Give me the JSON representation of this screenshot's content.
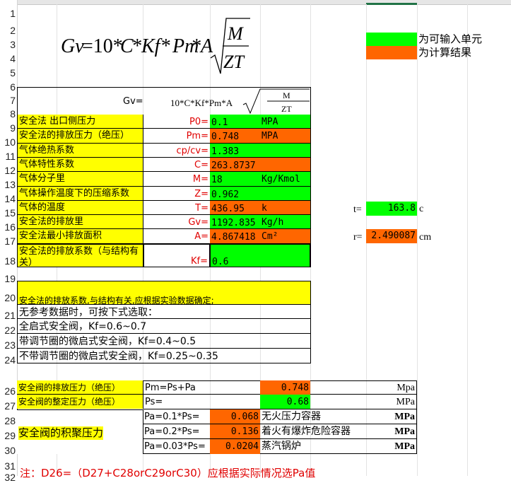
{
  "formula": {
    "lhs": "Gv",
    "eq": "=10*",
    "c": "C",
    "kf": "*Kf*",
    "pm": "Pm",
    "a": "*A",
    "num": "M",
    "den": "ZT"
  },
  "legend": {
    "input_label": "为可输入单元",
    "calc_label": "为计算结果"
  },
  "header_row": {
    "gv_label": "Gv=",
    "expr": "10*C*Kf*Pm*A",
    "num": "M",
    "den": "ZT"
  },
  "rows": [
    {
      "n": "9",
      "label": "安全法 出口侧压力",
      "sym": "P0=",
      "val": "0.1",
      "unit": "MPA",
      "color": "grn"
    },
    {
      "n": "10",
      "label": "安全法的排放压力（绝压）",
      "sym": "Pm=",
      "val": "0.748",
      "unit": "MPA",
      "color": "org"
    },
    {
      "n": "11",
      "label": "气体绝热系数",
      "sym": "cp/cv=",
      "val": "1.383",
      "unit": "",
      "color": "grn"
    },
    {
      "n": "12",
      "label": "气体特性系数",
      "sym": "C=",
      "val": "263.8737",
      "unit": "",
      "color": "org"
    },
    {
      "n": "13",
      "label": "气体分子里",
      "sym": "M=",
      "val": "18",
      "unit": "Kg/Kmol",
      "color": "grn"
    },
    {
      "n": "14",
      "label": "气体操作温度下的压缩系数",
      "sym": "Z=",
      "val": "0.962",
      "unit": "",
      "color": "grn"
    },
    {
      "n": "15",
      "label": "气体的温度",
      "sym": "T=",
      "val": "436.95",
      "unit": "k",
      "color": "org"
    },
    {
      "n": "16",
      "label": "安全法的排放里",
      "sym": "Gv=",
      "val": "1192.835",
      "unit": "Kg/h",
      "color": "grn"
    },
    {
      "n": "17",
      "label": "安全法最小排放面积",
      "sym": "A=",
      "val": "4.867418",
      "unit": "Cm²",
      "color": "org"
    }
  ],
  "row18": {
    "label_line1": "安全法的排放系数（与结构有",
    "label_line2": "关）",
    "sym": "Kf=",
    "val": "0.6"
  },
  "side": {
    "t_label": "t=",
    "t_val": "163.8",
    "t_unit": "c",
    "r_label": "r=",
    "r_val": "2.490087",
    "r_unit": "cm"
  },
  "notes": {
    "title": "安全法的排放系数,与结构有关,应根据实验数据确定;",
    "l21": "无参考数据时，可按下式选取：",
    "l22": "全启式安全阀，Kf=0.6~0.7",
    "l23": "带调节圈的微启式安全阀，Kf=0.4~0.5",
    "l24": "不带调节圈的微启式安全阀，Kf=0.25~0.35"
  },
  "valve": {
    "r26_label": "安全阀的排放压力（绝压）",
    "r26_formula": "Pm=Ps+Pa",
    "r26_val": "0.748",
    "r26_unit": "Mpa",
    "r27_label": "安全阀的整定压力（绝压）",
    "r27_formula": "Ps=",
    "r27_val": "0.68",
    "r27_unit": "MPa",
    "acc_label": "安全阀的积聚压力",
    "r28_formula": "Pa=0.1*Ps=",
    "r28_val": "0.068",
    "r28_desc": "无火压力容器",
    "r28_unit": "MPa",
    "r29_formula": "Pa=0.2*Ps=",
    "r29_val": "0.136",
    "r29_desc": "着火有爆炸危险容器",
    "r29_unit": "MPa",
    "r30_formula": "Pa=0.03*Ps=",
    "r30_val": "0.0204",
    "r30_desc": "蒸汽锅炉",
    "r30_unit": "MPa"
  },
  "footnote": "注：D26=（D27+C28orC29orC30）应根据实际情况选Pa值",
  "row_numbers": [
    "1",
    "2",
    "3",
    "4",
    "5",
    "6",
    "7",
    "8",
    "9",
    "10",
    "11",
    "12",
    "13",
    "14",
    "15",
    "16",
    "17",
    "18",
    "19",
    "20",
    "21",
    "22",
    "23",
    "24",
    "26",
    "27",
    "28",
    "29",
    "30",
    "31",
    "32"
  ]
}
